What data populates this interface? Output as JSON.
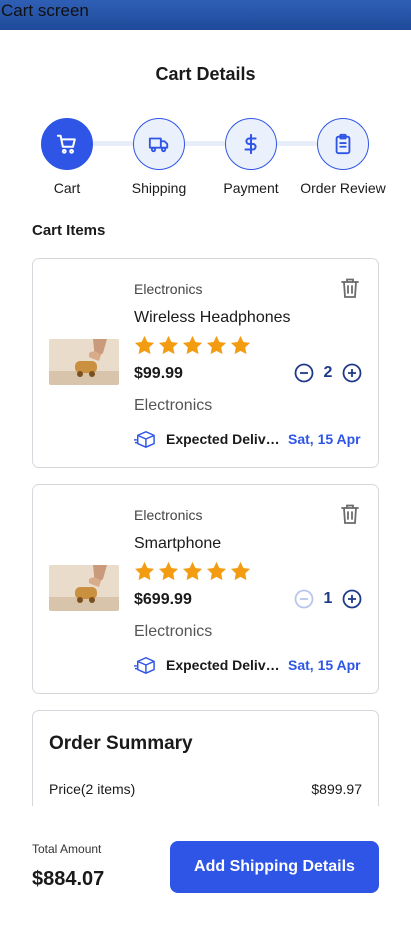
{
  "window": {
    "title": "Cart screen"
  },
  "page": {
    "title": "Cart Details"
  },
  "stepper": {
    "steps": [
      {
        "label": "Cart",
        "icon": "cart-icon",
        "active": true
      },
      {
        "label": "Shipping",
        "icon": "truck-icon",
        "active": false
      },
      {
        "label": "Payment",
        "icon": "dollar-icon",
        "active": false
      },
      {
        "label": "Order Review",
        "icon": "clipboard-icon",
        "active": false
      }
    ]
  },
  "cart": {
    "section_title": "Cart Items",
    "items": [
      {
        "category": "Electronics",
        "name": "Wireless Headphones",
        "rating": 5,
        "price": "$99.99",
        "quantity": "2",
        "decrement_enabled": true,
        "subcategory": "Electronics",
        "delivery_label": "Expected Delivery",
        "delivery_date": "Sat, 15 Apr"
      },
      {
        "category": "Electronics",
        "name": "Smartphone",
        "rating": 5,
        "price": "$699.99",
        "quantity": "1",
        "decrement_enabled": false,
        "subcategory": "Electronics",
        "delivery_label": "Expected Delivery",
        "delivery_date": "Sat, 15 Apr"
      }
    ]
  },
  "summary": {
    "title": "Order Summary",
    "rows": [
      {
        "label": "Price(2 items)",
        "value": "$899.97"
      }
    ]
  },
  "footer": {
    "total_label": "Total Amount",
    "total_value": "$884.07",
    "cta_label": "Add Shipping Details"
  },
  "colors": {
    "accent": "#2e55e6",
    "star": "#f39c12",
    "titlebar": "#2f5fb5"
  }
}
